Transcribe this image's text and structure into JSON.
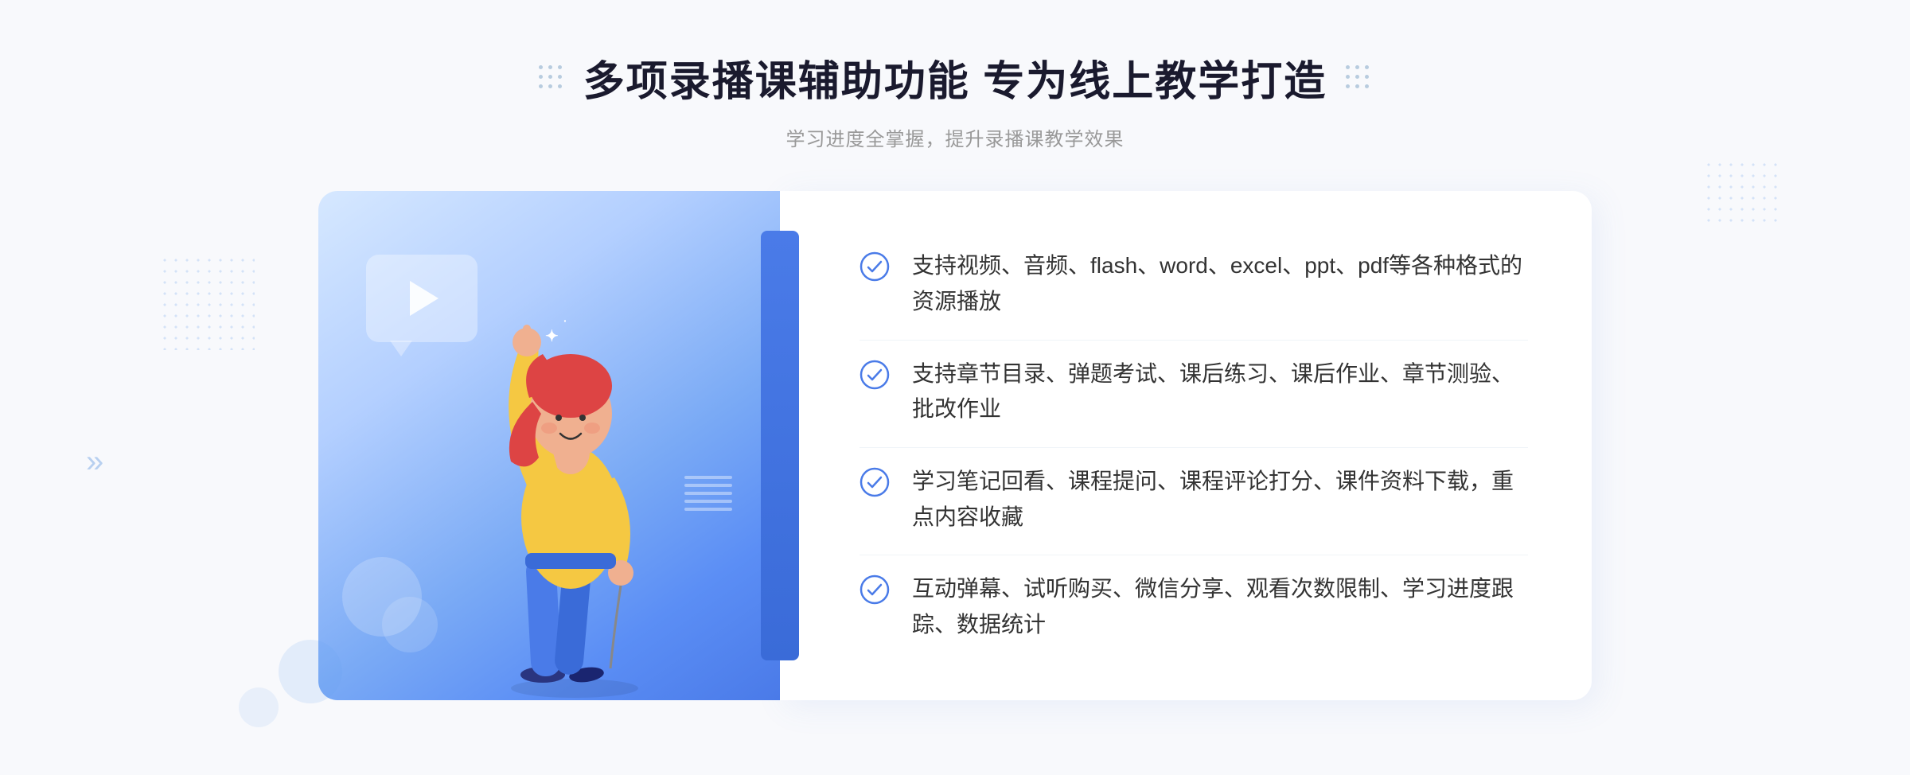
{
  "header": {
    "main_title": "多项录播课辅助功能 专为线上教学打造",
    "subtitle": "学习进度全掌握，提升录播课教学效果"
  },
  "features": [
    {
      "id": "feature-1",
      "text": "支持视频、音频、flash、word、excel、ppt、pdf等各种格式的资源播放"
    },
    {
      "id": "feature-2",
      "text": "支持章节目录、弹题考试、课后练习、课后作业、章节测验、批改作业"
    },
    {
      "id": "feature-3",
      "text": "学习笔记回看、课程提问、课程评论打分、课件资料下载，重点内容收藏"
    },
    {
      "id": "feature-4",
      "text": "互动弹幕、试听购买、微信分享、观看次数限制、学习进度跟踪、数据统计"
    }
  ],
  "decorators": {
    "left_arrow": "»",
    "check_color": "#4a7be8",
    "title_color": "#1a1a2e",
    "subtitle_color": "#999999"
  }
}
